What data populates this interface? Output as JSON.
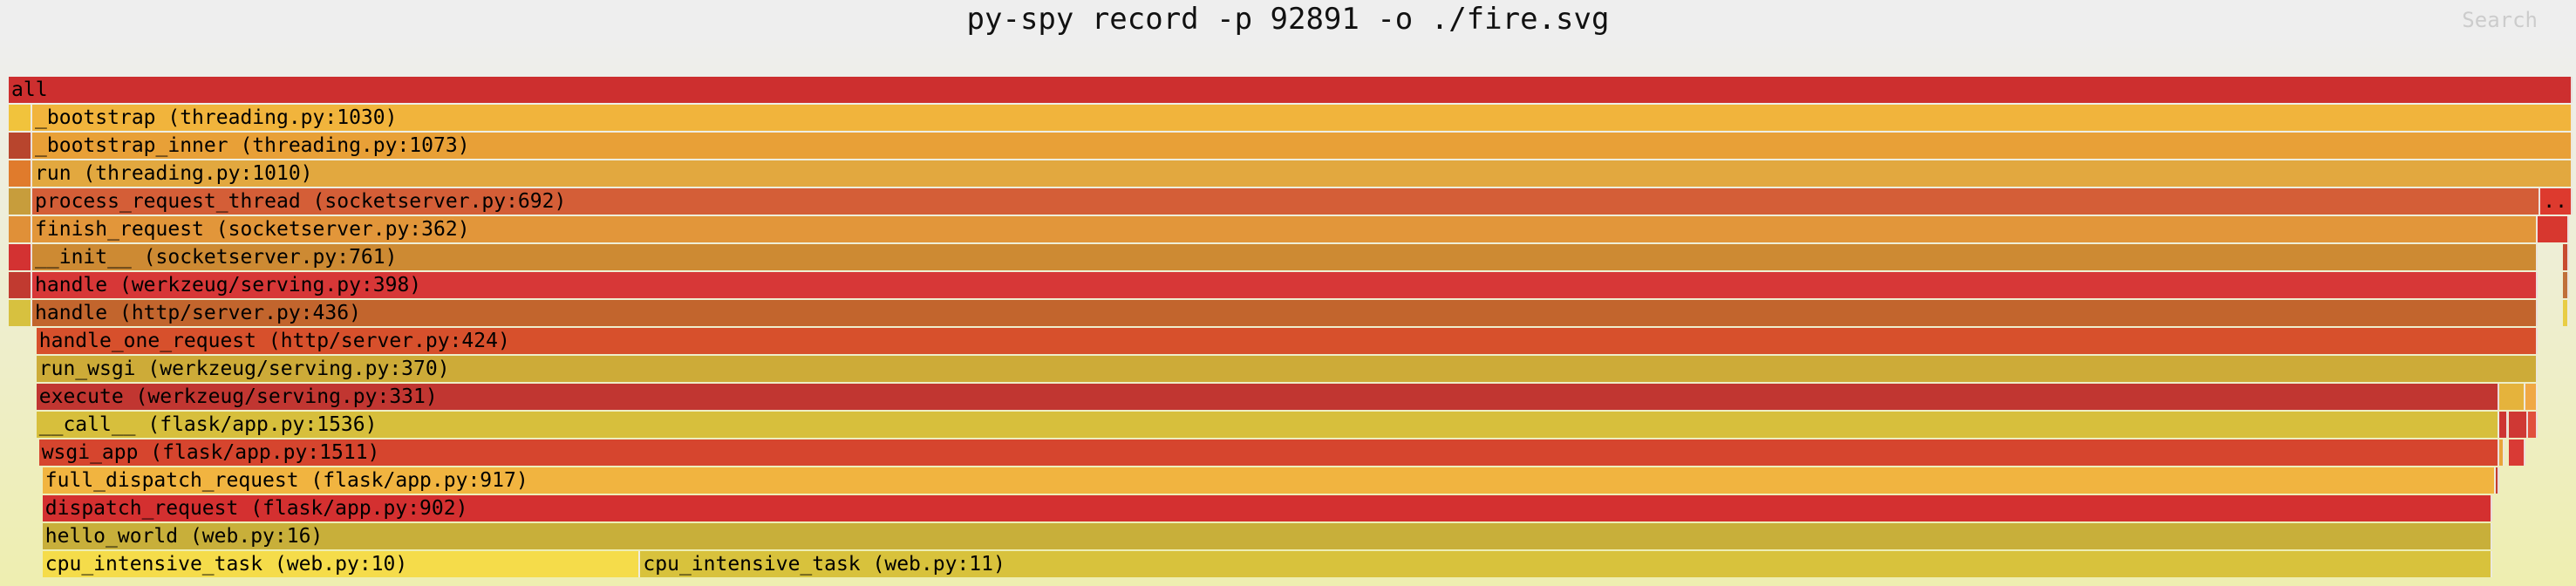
{
  "title": "py-spy record -p 92891 -o ./fire.svg",
  "search_label": "Search",
  "rows": [
    [
      {
        "label": "all",
        "x0": 0.0,
        "x1": 1.0,
        "color": "#cd2f2f"
      }
    ],
    [
      {
        "label": "",
        "x0": 0.0,
        "x1": 0.0092,
        "color": "#f1c33c"
      },
      {
        "label": "_bootstrap (threading.py:1030)",
        "x0": 0.0092,
        "x1": 1.0,
        "color": "#f1b43c"
      }
    ],
    [
      {
        "label": "",
        "x0": 0.0,
        "x1": 0.0092,
        "color": "#b8452d"
      },
      {
        "label": "_bootstrap_inner (threading.py:1073)",
        "x0": 0.0092,
        "x1": 1.0,
        "color": "#e8a037"
      }
    ],
    [
      {
        "label": "",
        "x0": 0.0,
        "x1": 0.0092,
        "color": "#e07b2c"
      },
      {
        "label": "run (threading.py:1010)",
        "x0": 0.0092,
        "x1": 1.0,
        "color": "#e2a83f"
      }
    ],
    [
      {
        "label": "",
        "x0": 0.0,
        "x1": 0.0092,
        "color": "#c79d3c"
      },
      {
        "label": "process_request_thread (socketserver.py:692)",
        "x0": 0.0092,
        "x1": 0.9875,
        "color": "#d45e37"
      },
      {
        "label": "..",
        "x0": 0.9875,
        "x1": 1.0,
        "color": "#dd3a2e"
      }
    ],
    [
      {
        "label": "",
        "x0": 0.0,
        "x1": 0.0092,
        "color": "#e09038"
      },
      {
        "label": "finish_request (socketserver.py:362)",
        "x0": 0.0092,
        "x1": 0.9863,
        "color": "#e2963a"
      },
      {
        "label": "",
        "x0": 0.9863,
        "x1": 0.9986,
        "color": "#d7372f"
      }
    ],
    [
      {
        "label": "",
        "x0": 0.0,
        "x1": 0.0092,
        "color": "#d33232"
      },
      {
        "label": "__init__ (socketserver.py:761)",
        "x0": 0.0092,
        "x1": 0.9863,
        "color": "#cd8a33"
      },
      {
        "label": "",
        "x0": 0.9962,
        "x1": 0.9986,
        "color": "#c84b30"
      }
    ],
    [
      {
        "label": "",
        "x0": 0.0,
        "x1": 0.0092,
        "color": "#c13a30"
      },
      {
        "label": "handle (werkzeug/serving.py:398)",
        "x0": 0.0092,
        "x1": 0.9863,
        "color": "#d73737"
      },
      {
        "label": "",
        "x0": 0.9962,
        "x1": 0.9986,
        "color": "#c0703a"
      }
    ],
    [
      {
        "label": "",
        "x0": 0.0,
        "x1": 0.0092,
        "color": "#d7c13f"
      },
      {
        "label": "handle (http/server.py:436)",
        "x0": 0.0092,
        "x1": 0.9863,
        "color": "#c2652d"
      },
      {
        "label": "",
        "x0": 0.9962,
        "x1": 0.9986,
        "color": "#e8cd45"
      }
    ],
    [
      {
        "label": "handle_one_request (http/server.py:424)",
        "x0": 0.0108,
        "x1": 0.9863,
        "color": "#d7502c"
      }
    ],
    [
      {
        "label": "run_wsgi (werkzeug/serving.py:370)",
        "x0": 0.0108,
        "x1": 0.9863,
        "color": "#cdab38"
      }
    ],
    [
      {
        "label": "execute (werkzeug/serving.py:331)",
        "x0": 0.0108,
        "x1": 0.9713,
        "color": "#c13631"
      },
      {
        "label": "",
        "x0": 0.9713,
        "x1": 0.9815,
        "color": "#e5b33c"
      },
      {
        "label": "",
        "x0": 0.9815,
        "x1": 0.9863,
        "color": "#f0a845"
      }
    ],
    [
      {
        "label": "__call__ (flask/app.py:1536)",
        "x0": 0.0108,
        "x1": 0.9713,
        "color": "#d7bf3c"
      },
      {
        "label": "",
        "x0": 0.9713,
        "x1": 0.975,
        "color": "#cd3632"
      },
      {
        "label": "",
        "x0": 0.975,
        "x1": 0.9825,
        "color": "#cf3834"
      },
      {
        "label": "",
        "x0": 0.9825,
        "x1": 0.9863,
        "color": "#e1503d"
      }
    ],
    [
      {
        "label": "wsgi_app (flask/app.py:1511)",
        "x0": 0.0118,
        "x1": 0.9713,
        "color": "#d6452e"
      },
      {
        "label": "",
        "x0": 0.9713,
        "x1": 0.9734,
        "color": "#e8a53a"
      },
      {
        "label": "",
        "x0": 0.975,
        "x1": 0.9815,
        "color": "#d93a35"
      }
    ],
    [
      {
        "label": "full_dispatch_request (flask/app.py:917)",
        "x0": 0.0132,
        "x1": 0.97,
        "color": "#f1b440"
      },
      {
        "label": "",
        "x0": 0.97,
        "x1": 0.9713,
        "color": "#c43a2e"
      }
    ],
    [
      {
        "label": "dispatch_request (flask/app.py:902)",
        "x0": 0.0132,
        "x1": 0.9688,
        "color": "#d43030"
      }
    ],
    [
      {
        "label": "hello_world (web.py:16)",
        "x0": 0.0132,
        "x1": 0.9688,
        "color": "#c8af3a"
      }
    ],
    [
      {
        "label": "cpu_intensive_task (web.py:10)",
        "x0": 0.0132,
        "x1": 0.2464,
        "color": "#f5dc4a"
      },
      {
        "label": "cpu_intensive_task (web.py:11)",
        "x0": 0.2464,
        "x1": 0.9688,
        "color": "#d8c23c"
      }
    ]
  ]
}
